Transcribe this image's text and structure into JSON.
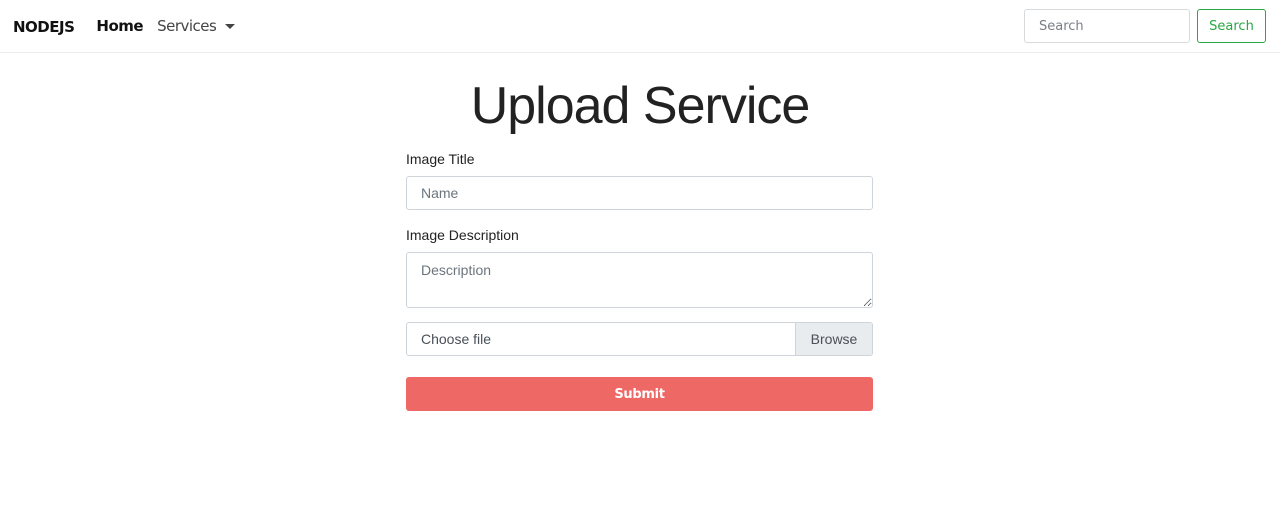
{
  "navbar": {
    "brand": "NODEJS",
    "links": [
      {
        "label": "Home"
      },
      {
        "label": "Services"
      }
    ],
    "search": {
      "placeholder": "Search",
      "value": "",
      "button_label": "Search"
    }
  },
  "main": {
    "title": "Upload Service",
    "form": {
      "title_label": "Image Title",
      "title_placeholder": "Name",
      "description_label": "Image Description",
      "description_placeholder": "Description",
      "file_label": "Choose file",
      "browse_label": "Browse",
      "submit_label": "Submit"
    }
  },
  "colors": {
    "submit": "#ee6966",
    "search_button": "#28a745"
  }
}
